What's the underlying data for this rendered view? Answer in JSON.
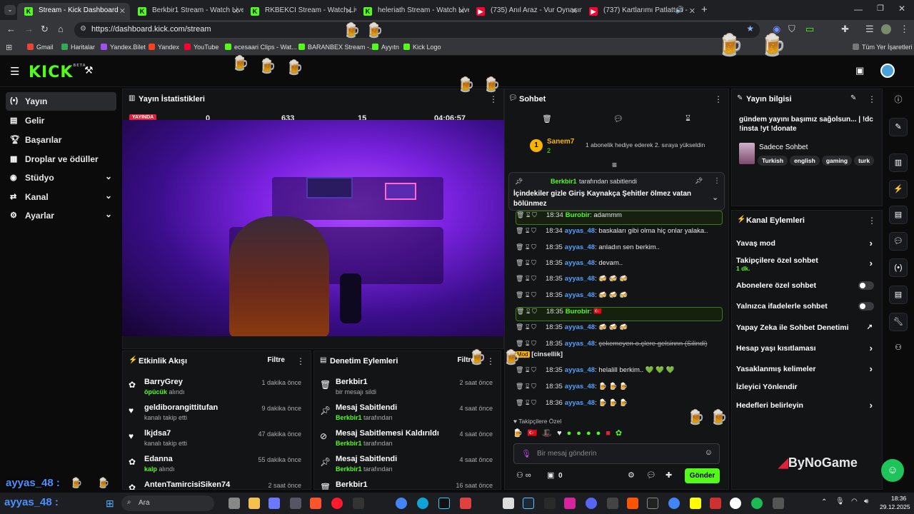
{
  "browser": {
    "tabs": [
      {
        "label": "Stream - Kick Dashboard",
        "fav": "K"
      },
      {
        "label": "Berkbir1 Stream - Watch Live o",
        "fav": "K"
      },
      {
        "label": "RKBEKCI Stream - Watch Live o",
        "fav": "K"
      },
      {
        "label": "heleriath Stream - Watch Live o",
        "fav": "K"
      },
      {
        "label": "(735) Anıl Araz - Vur Oynasın Te",
        "fav": "Y"
      },
      {
        "label": "(737) Kartlarımı Patlattım -",
        "fav": "Y"
      }
    ],
    "url": "https://dashboard.kick.com/stream",
    "bookmarks": [
      "Gmail",
      "Haritalar",
      "Yandex.Bilet",
      "Yandex",
      "YouTube",
      "ecesaari Clips - Wat...",
      "BARANBEX Stream -...",
      "Ayyıtn",
      "Kick Logo"
    ],
    "all_bookmarks": "Tüm Yer İşaretleri"
  },
  "app": {
    "logo": "KICK",
    "logo_beta": "BETA",
    "sidebar": [
      {
        "label": "Yayın",
        "icon": "broadcast-icon"
      },
      {
        "label": "Gelir",
        "icon": "wallet-icon"
      },
      {
        "label": "Başarılar",
        "icon": "trophy-icon"
      },
      {
        "label": "Droplar ve ödüller",
        "icon": "gift-icon"
      },
      {
        "label": "Stüdyo",
        "icon": "studio-icon"
      },
      {
        "label": "Kanal",
        "icon": "channel-icon"
      },
      {
        "label": "Ayarlar",
        "icon": "gear-icon"
      }
    ],
    "stats": {
      "title": "Yayın İstatistikleri",
      "live_badge": "YAYINDA",
      "values": [
        "0",
        "633",
        "15",
        "04:06:57"
      ]
    },
    "activity": {
      "title": "Etkinlik Akışı",
      "filter": "Filtre",
      "items": [
        {
          "name": "BarryGrey",
          "action": "alındı",
          "highlight": "öpücük",
          "time": "1 dakika önce",
          "icon": "gift-icon"
        },
        {
          "name": "geldiborangittitufan",
          "action": "kanalı takip etti",
          "highlight": "",
          "time": "9 dakika önce",
          "icon": "heart-icon"
        },
        {
          "name": "lkjdsa7",
          "action": "kanalı takip etti",
          "highlight": "",
          "time": "47 dakika önce",
          "icon": "heart-icon"
        },
        {
          "name": "Edanna",
          "action": "alındı",
          "highlight": "kalp",
          "time": "55 dakika önce",
          "icon": "gift-icon"
        },
        {
          "name": "AntenTamircisiSiken74",
          "action": "",
          "highlight": "",
          "time": "2 saat önce",
          "icon": "gift-icon"
        }
      ]
    },
    "moderation": {
      "title": "Denetim Eylemleri",
      "filter": "Filtre",
      "items": [
        {
          "name": "Berkbir1",
          "sub": "bir mesajı sildi",
          "by": "",
          "time": "2 saat önce",
          "icon": "trash-icon"
        },
        {
          "name": "Mesaj Sabitlendi",
          "sub": "tarafından",
          "by": "Berkbir1",
          "time": "4 saat önce",
          "icon": "pin-icon"
        },
        {
          "name": "Mesaj Sabitlemesi Kaldırıldı",
          "sub": "tarafından",
          "by": "Berkbir1",
          "time": "4 saat önce",
          "icon": "unpin-icon"
        },
        {
          "name": "Mesaj Sabitlendi",
          "sub": "tarafından",
          "by": "Berkbir1",
          "time": "4 saat önce",
          "icon": "pin-icon"
        },
        {
          "name": "Berkbir1",
          "sub": "",
          "by": "",
          "time": "16 saat önce",
          "icon": "trash-icon"
        }
      ]
    },
    "chat": {
      "title": "Sohbet",
      "top_gifter": {
        "rank": "1",
        "name": "Sanem7",
        "count": "2",
        "note": "1 abonelik hediye ederek 2. sıraya yükseldin"
      },
      "pinned": {
        "by": "Berkbir1",
        "by_suffix": "tarafından sabitlendi",
        "text": "İçindekiler gizle Giriş Kaynakça Şehitler ölmez vatan bölünmez"
      },
      "messages": [
        {
          "time": "18:34",
          "user": "Burobir",
          "text": "adammm",
          "green": true,
          "hl": true
        },
        {
          "time": "18:34",
          "user": "ayyas_48",
          "text": "baskaları gibi olma hiç onlar yalaka..",
          "green": false,
          "hl": false
        },
        {
          "time": "18:35",
          "user": "ayyas_48",
          "text": "anladın sen berkim..",
          "green": false,
          "hl": false
        },
        {
          "time": "18:35",
          "user": "ayyas_48",
          "text": "devam..",
          "green": false,
          "hl": false
        },
        {
          "time": "18:35",
          "user": "ayyas_48",
          "text": "🍻 🍻 🍻",
          "green": false,
          "hl": false
        },
        {
          "time": "18:35",
          "user": "ayyas_48",
          "text": "🍻 🍻 🍻",
          "green": false,
          "hl": false
        },
        {
          "time": "18:35",
          "user": "Burobir",
          "text": "🇹🇷",
          "green": true,
          "hl": true
        },
        {
          "time": "18:35",
          "user": "ayyas_48",
          "text": "🍻 🍻 🍻",
          "green": false,
          "hl": false
        },
        {
          "time": "18:35",
          "user": "ayyas_48",
          "text": "çekemeyen o.çlere gelsinnn (Silindi)",
          "green": false,
          "hl": false
        },
        {
          "time": "18:35",
          "user": "ayyas_48",
          "text": "helalill berkim.. 💚 💚 💚",
          "green": false,
          "hl": false
        },
        {
          "time": "18:35",
          "user": "ayyas_48",
          "text": "🍺 🍺 🍺",
          "green": false,
          "hl": false
        },
        {
          "time": "18:36",
          "user": "ayyas_48",
          "text": "🍺 🍺 🍺",
          "green": false,
          "hl": false
        }
      ],
      "mod_note": "[cinsellik]",
      "mod_label": "Mod",
      "followers_only": "Takipçilere Özel",
      "input_placeholder": "Bir mesaj gönderin",
      "send": "Gönder",
      "viewers": "0"
    },
    "stream_info": {
      "title": "Yayın bilgisi",
      "headline": "gündem yayını başımız sağolsun... | !dc !insta !yt !donate",
      "category": "Sadece Sohbet",
      "tags": [
        "Turkish",
        "english",
        "gaming",
        "turk"
      ]
    },
    "channel_actions": {
      "title": "Kanal Eylemleri",
      "rows": [
        {
          "label": "Yavaş mod",
          "kind": "chev",
          "sub": ""
        },
        {
          "label": "Takipçilere özel sohbet",
          "kind": "chev",
          "sub": "1 dk."
        },
        {
          "label": "Abonelere özel sohbet",
          "kind": "toggle",
          "sub": ""
        },
        {
          "label": "Yalnızca ifadelerle sohbet",
          "kind": "toggle",
          "sub": ""
        },
        {
          "label": "Yapay Zeka ile Sohbet Denetimi",
          "kind": "ext",
          "sub": ""
        },
        {
          "label": "Hesap yaşı kısıtlaması",
          "kind": "chev",
          "sub": ""
        },
        {
          "label": "Yasaklanmış kelimeler",
          "kind": "chev",
          "sub": ""
        },
        {
          "label": "İzleyici Yönlendir",
          "kind": "none",
          "sub": ""
        },
        {
          "label": "Hedefleri belirleyin",
          "kind": "chev",
          "sub": ""
        }
      ]
    },
    "overlay": {
      "user": "ayyas_48 :",
      "watermark": "ByNoGame"
    }
  },
  "taskbar": {
    "search": "Ara",
    "time": "18:36",
    "date": "29.12.2025"
  }
}
